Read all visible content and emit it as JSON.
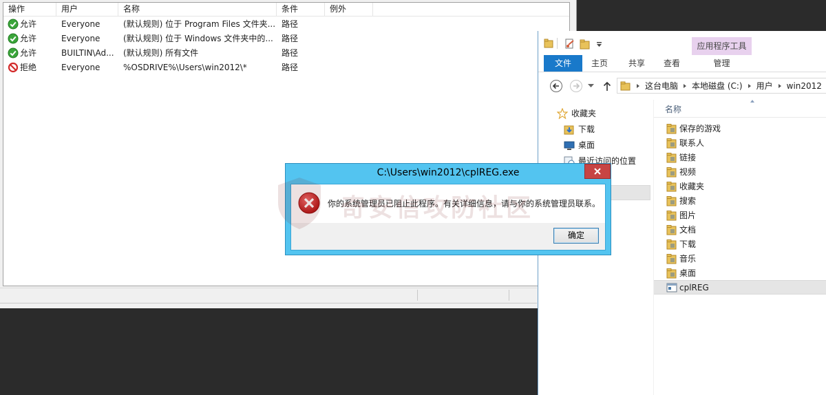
{
  "rules": {
    "columns": [
      "操作",
      "用户",
      "名称",
      "条件",
      "例外"
    ],
    "rows": [
      {
        "action": "允许",
        "action_type": "allow",
        "user": "Everyone",
        "name": "(默认规则) 位于 Program Files 文件夹...",
        "condition": "路径",
        "exception": ""
      },
      {
        "action": "允许",
        "action_type": "allow",
        "user": "Everyone",
        "name": "(默认规则) 位于 Windows 文件夹中的...",
        "condition": "路径",
        "exception": ""
      },
      {
        "action": "允许",
        "action_type": "allow",
        "user": "BUILTIN\\Ad...",
        "name": "(默认规则) 所有文件",
        "condition": "路径",
        "exception": ""
      },
      {
        "action": "拒绝",
        "action_type": "deny",
        "user": "Everyone",
        "name": "%OSDRIVE%\\Users\\win2012\\*",
        "condition": "路径",
        "exception": ""
      }
    ]
  },
  "explorer": {
    "contextual_tab": "应用程序工具",
    "tabs": {
      "file": "文件",
      "home": "主页",
      "share": "共享",
      "view": "查看",
      "manage": "管理"
    },
    "breadcrumb": [
      "这台电脑",
      "本地磁盘 (C:)",
      "用户",
      "win2012"
    ],
    "nav": {
      "favorites": "收藏夹",
      "downloads": "下载",
      "desktop": "桌面",
      "recent": "最近访问的位置"
    },
    "column_name": "名称",
    "items": [
      {
        "label": "保存的游戏",
        "icon": "saved-games-folder-icon"
      },
      {
        "label": "联系人",
        "icon": "contacts-folder-icon"
      },
      {
        "label": "链接",
        "icon": "links-folder-icon"
      },
      {
        "label": "视频",
        "icon": "videos-folder-icon"
      },
      {
        "label": "收藏夹",
        "icon": "favorites-folder-icon"
      },
      {
        "label": "搜索",
        "icon": "searches-folder-icon"
      },
      {
        "label": "图片",
        "icon": "pictures-folder-icon"
      },
      {
        "label": "文档",
        "icon": "documents-folder-icon"
      },
      {
        "label": "下载",
        "icon": "downloads-folder-icon"
      },
      {
        "label": "音乐",
        "icon": "music-folder-icon"
      },
      {
        "label": "桌面",
        "icon": "desktop-folder-icon"
      },
      {
        "label": "cplREG",
        "icon": "application-icon",
        "selected": true
      }
    ]
  },
  "dialog": {
    "title": "C:\\Users\\win2012\\cplREG.exe",
    "message": "你的系统管理员已阻止此程序。有关详细信息，请与你的系统管理员联系。",
    "ok_label": "确定"
  },
  "watermark": "奇安信攻防社区",
  "colors": {
    "dialog_frame": "#53c4f0",
    "file_tab": "#1979ca",
    "contextual_tab": "#e8d1ee",
    "close_button": "#c74444",
    "allow_green": "#3aa53a",
    "deny_red": "#d32b2b"
  }
}
